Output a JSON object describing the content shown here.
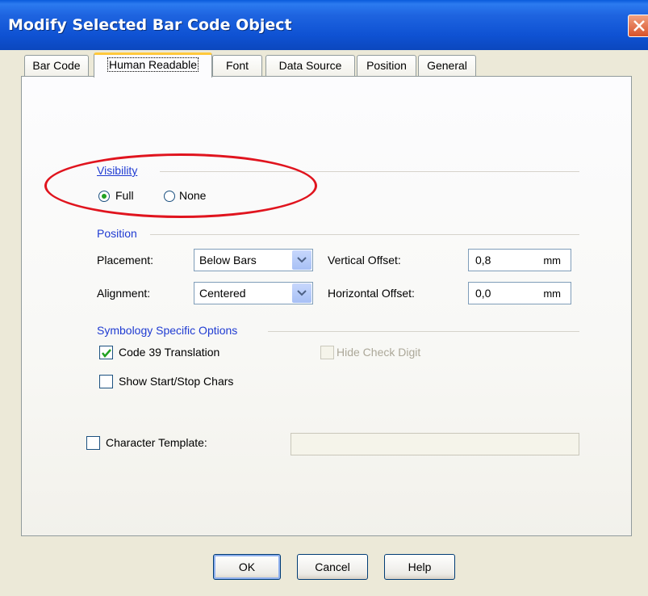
{
  "window": {
    "title": "Modify Selected Bar Code Object"
  },
  "tabs": [
    {
      "label": "Bar Code"
    },
    {
      "label": "Human Readable"
    },
    {
      "label": "Font"
    },
    {
      "label": "Data Source"
    },
    {
      "label": "Position"
    },
    {
      "label": "General"
    }
  ],
  "visibility": {
    "group_label": "Visibility",
    "full_label": "Full",
    "none_label": "None",
    "selected": "Full"
  },
  "position": {
    "group_label": "Position",
    "placement_label": "Placement:",
    "placement_value": "Below Bars",
    "alignment_label": "Alignment:",
    "alignment_value": "Centered",
    "vertical_offset_label": "Vertical Offset:",
    "vertical_offset_value": "0,8",
    "vertical_offset_unit": "mm",
    "horizontal_offset_label": "Horizontal Offset:",
    "horizontal_offset_value": "0,0",
    "horizontal_offset_unit": "mm"
  },
  "symbology": {
    "group_label": "Symbology Specific Options",
    "code39_label": "Code 39 Translation",
    "code39_checked": true,
    "hide_check_digit_label": "Hide Check Digit",
    "start_stop_label": "Show Start/Stop Chars",
    "start_stop_checked": false
  },
  "template": {
    "label": "Character Template:",
    "value": ""
  },
  "buttons": {
    "ok": "OK",
    "cancel": "Cancel",
    "help": "Help"
  },
  "colors": {
    "titlebar": "#0F52D3",
    "group_label": "#1F3BD2",
    "annotation": "#E0141E"
  }
}
